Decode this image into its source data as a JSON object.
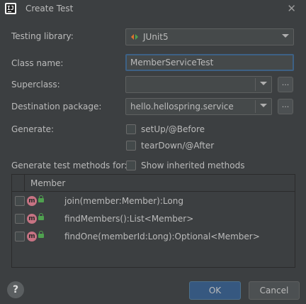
{
  "window": {
    "title": "Create Test",
    "app_icon": "intellij-icon",
    "close_icon": "close-icon"
  },
  "form": {
    "testing_library_label": "Testing library:",
    "testing_library_value": "JUnit5",
    "class_name_label": "Class name:",
    "class_name_value": "MemberServiceTest",
    "superclass_label": "Superclass:",
    "superclass_value": "",
    "superclass_browse": "...",
    "destination_label": "Destination package:",
    "destination_value": "hello.hellospring.service",
    "destination_browse": "...",
    "generate_label": "Generate:",
    "generate_options": [
      {
        "label": "setUp/@Before",
        "checked": false
      },
      {
        "label": "tearDown/@After",
        "checked": false
      }
    ],
    "methods_label": "Generate test methods for:",
    "show_inherited_label": "Show inherited methods"
  },
  "table": {
    "header": "Member",
    "rows": [
      {
        "icon": "m",
        "label": "join(member:Member):Long"
      },
      {
        "icon": "m",
        "label": "findMembers():List<Member>"
      },
      {
        "icon": "m",
        "label": "findOne(memberId:Long):Optional<Member>"
      }
    ]
  },
  "footer": {
    "help_label": "?",
    "ok_label": "OK",
    "cancel_label": "Cancel"
  },
  "colors": {
    "background": "#3c3f41",
    "accent": "#365880",
    "focus_border": "#3d6185",
    "method_icon": "#c77383"
  }
}
